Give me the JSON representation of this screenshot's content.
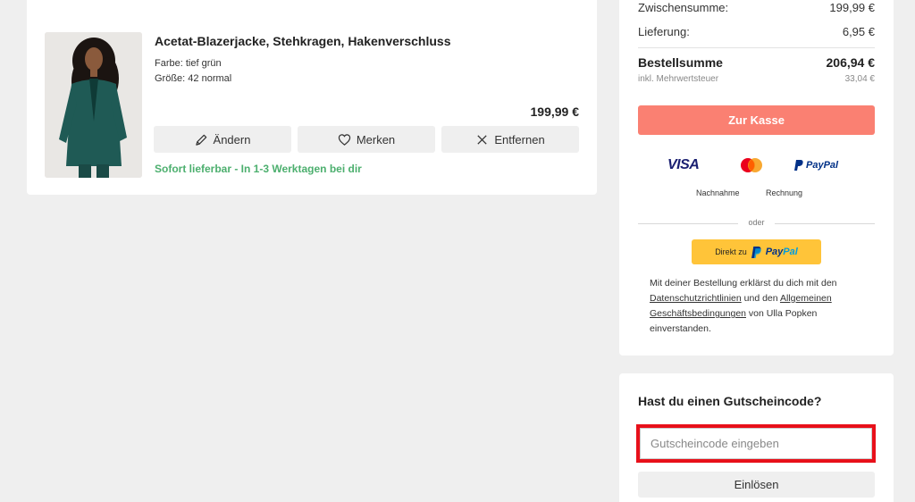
{
  "product": {
    "title": "Acetat-Blazerjacke, Stehkragen, Hakenverschluss",
    "color_line": "Farbe: tief grün",
    "size_line": "Größe: 42 normal",
    "price": "199,99 €",
    "image_icon": "product-photo-green-blazer",
    "actions": [
      {
        "label": "Ändern",
        "icon": "pencil-icon"
      },
      {
        "label": "Merken",
        "icon": "heart-icon"
      },
      {
        "label": "Entfernen",
        "icon": "close-icon"
      }
    ],
    "delivery": "Sofort lieferbar - In 1-3 Werktagen bei dir",
    "delivery_color": "#4caf6e"
  },
  "summary": {
    "subtotal_label": "Zwischensumme:",
    "subtotal_value": "199,99 €",
    "shipping_label": "Lieferung:",
    "shipping_value": "6,95 €",
    "total_label": "Bestellsumme",
    "total_value": "206,94 €",
    "tax_label": "inkl. Mehrwertsteuer",
    "tax_value": "33,04 €",
    "checkout_label": "Zur Kasse",
    "checkout_color": "#fa8072",
    "payments": {
      "visa": "VISA",
      "paypal": "PayPal",
      "nachnahme": "Nachnahme",
      "rechnung": "Rechnung"
    },
    "or_label": "oder",
    "paypal_direct": "Direkt zu",
    "paypal_brand_a": "Pay",
    "paypal_brand_b": "Pal",
    "legal": {
      "part1": "Mit deiner Bestellung erklärst du dich mit den ",
      "link1": "Datenschutzrichtlinien",
      "part2": " und den ",
      "link2": "Allgemeinen Geschäftsbedingungen",
      "part3": " von Ulla Popken einverstanden."
    }
  },
  "voucher": {
    "title": "Hast du einen Gutscheincode?",
    "placeholder": "Gutscheincode eingeben",
    "highlight_color": "#e8101a",
    "redeem_label": "Einlösen"
  }
}
